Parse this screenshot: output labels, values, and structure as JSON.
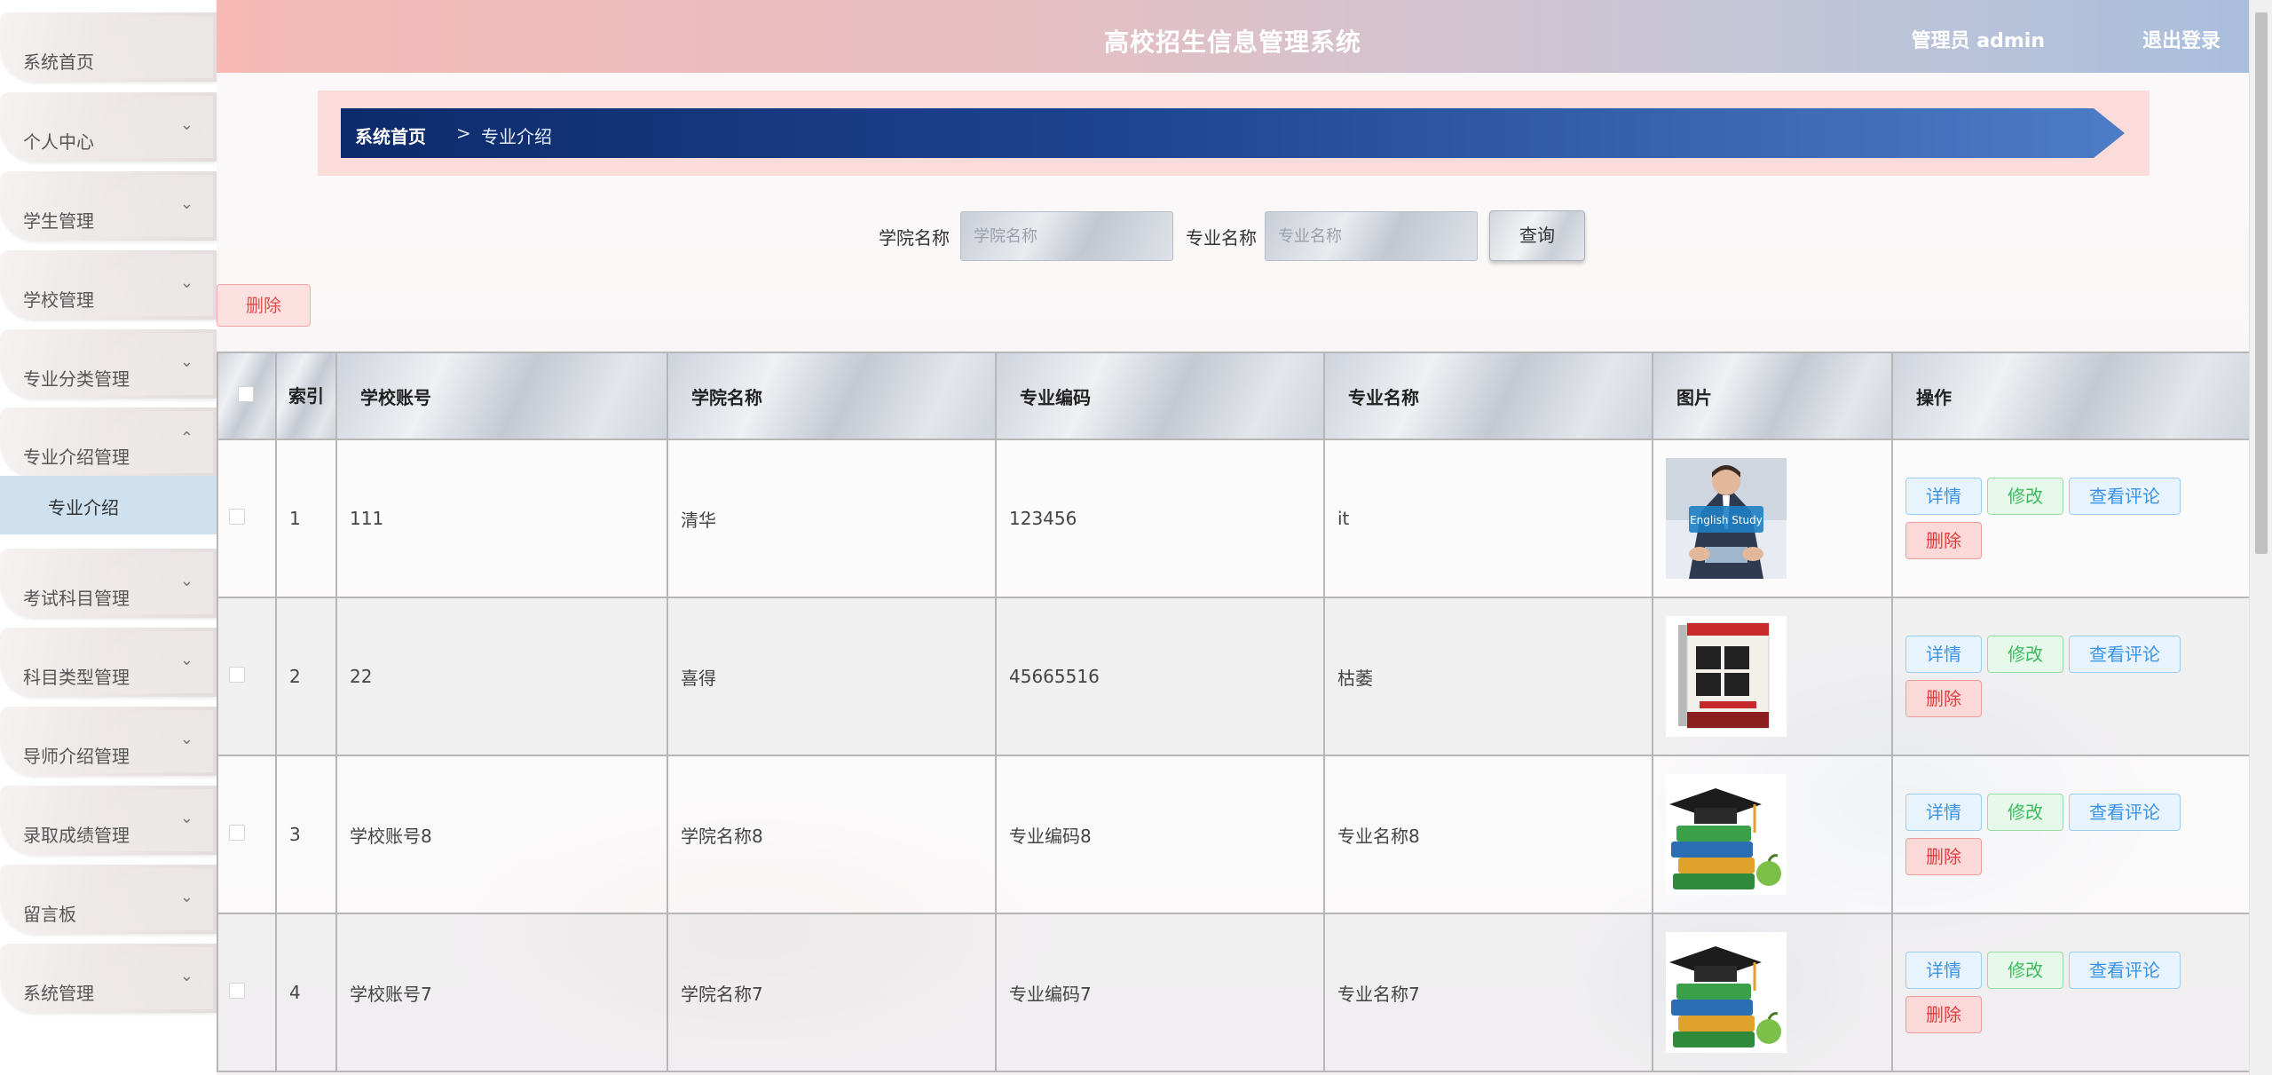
{
  "app": {
    "title": "高校招生信息管理系统",
    "user": "管理员 admin",
    "logout": "退出登录"
  },
  "sidebar": {
    "items": [
      {
        "label": "系统首页",
        "has_chevron": false
      },
      {
        "label": "个人中心",
        "has_chevron": true
      },
      {
        "label": "学生管理",
        "has_chevron": true
      },
      {
        "label": "学校管理",
        "has_chevron": true
      },
      {
        "label": "专业分类管理",
        "has_chevron": true
      },
      {
        "label": "专业介绍管理",
        "has_chevron": true,
        "expanded": true
      },
      {
        "label": "考试科目管理",
        "has_chevron": true
      },
      {
        "label": "科目类型管理",
        "has_chevron": true
      },
      {
        "label": "导师介绍管理",
        "has_chevron": true
      },
      {
        "label": "录取成绩管理",
        "has_chevron": true
      },
      {
        "label": "留言板",
        "has_chevron": true
      },
      {
        "label": "系统管理",
        "has_chevron": true
      }
    ],
    "submenu": {
      "label": "专业介绍",
      "active": true
    }
  },
  "breadcrumb": {
    "home": "系统首页",
    "separator": ">",
    "current": "专业介绍"
  },
  "search": {
    "college_label": "学院名称",
    "college_placeholder": "学院名称",
    "major_label": "专业名称",
    "major_placeholder": "专业名称",
    "query_button": "查询"
  },
  "actions": {
    "batch_delete": "删除"
  },
  "table": {
    "headers": {
      "index": "索引",
      "school_account": "学校账号",
      "college_name": "学院名称",
      "major_code": "专业编码",
      "major_name": "专业名称",
      "image": "图片",
      "operations": "操作"
    },
    "rows": [
      {
        "index": "1",
        "school_account": "111",
        "college_name": "清华",
        "major_code": "123456",
        "major_name": "it",
        "image": "english-study-photo"
      },
      {
        "index": "2",
        "school_account": "22",
        "college_name": "喜得",
        "major_code": "45665516",
        "major_name": "枯萎",
        "image": "politics-book-cover"
      },
      {
        "index": "3",
        "school_account": "学校账号8",
        "college_name": "学院名称8",
        "major_code": "专业编码8",
        "major_name": "专业名称8",
        "image": "graduation-books-icon"
      },
      {
        "index": "4",
        "school_account": "学校账号7",
        "college_name": "学院名称7",
        "major_code": "专业编码7",
        "major_name": "专业名称7",
        "image": "graduation-books-icon"
      }
    ],
    "op_labels": {
      "detail": "详情",
      "edit": "修改",
      "review": "查看评论",
      "delete": "删除"
    }
  },
  "colors": {
    "header_left": "#f6b9b4",
    "header_right": "#a9bedc",
    "breadcrumb_bg": "#fcdcda",
    "breadcrumb_dark": "#0d2a6b",
    "breadcrumb_light": "#4d7cc7",
    "submenu_active": "#cfe0ef"
  }
}
